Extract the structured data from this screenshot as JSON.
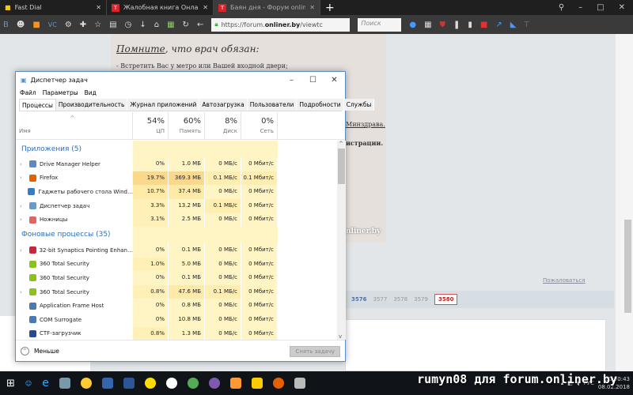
{
  "browser": {
    "tabs": [
      {
        "label": "Fast Dial"
      },
      {
        "label": "Жалобная книга Онлайн…"
      },
      {
        "label": "Баян дня - Форум onliner…",
        "active": true
      }
    ],
    "url_prefix": "https://forum.",
    "url_domain": "onliner.by",
    "url_suffix": "/viewtc",
    "search_placeholder": "Поиск"
  },
  "page": {
    "heading_underlined": "Помните",
    "heading_rest": ", что врач обязан:",
    "line1": "- Встретить Вас у метро или Вашей входной двери;",
    "frag_minzdrav": "Минздрава.",
    "frag_admin": "истрации.",
    "frag_onliner": "nliner.by",
    "complain": "Пожаловаться",
    "pager": [
      {
        "label": "3576",
        "type": "link"
      },
      {
        "label": "3577"
      },
      {
        "label": "3578"
      },
      {
        "label": "3579"
      },
      {
        "label": "3580",
        "type": "current"
      }
    ]
  },
  "taskmgr": {
    "title": "Диспетчер задач",
    "menu": [
      "Файл",
      "Параметры",
      "Вид"
    ],
    "tabs": [
      "Процессы",
      "Производительность",
      "Журнал приложений",
      "Автозагрузка",
      "Пользователи",
      "Подробности",
      "Службы"
    ],
    "columns": [
      {
        "pct": "",
        "name": "Имя"
      },
      {
        "pct": "54%",
        "name": "ЦП"
      },
      {
        "pct": "60%",
        "name": "Память"
      },
      {
        "pct": "8%",
        "name": "Диск"
      },
      {
        "pct": "0%",
        "name": "Сеть"
      }
    ],
    "groups": [
      {
        "title": "Приложения (5)",
        "rows": [
          {
            "name": "Drive Manager Helper",
            "exp": true,
            "cpu": "0%",
            "mem": "1.0 МБ",
            "disk": "0 МБ/с",
            "net": "0 Мбит/с",
            "icon": "#5a8bc4"
          },
          {
            "name": "Firefox",
            "exp": true,
            "cpu": "19.7%",
            "mem": "369.3 МБ",
            "disk": "0.1 МБ/с",
            "net": "0.1 Мбит/с",
            "icon": "#e66000",
            "hot": true
          },
          {
            "name": "Гаджеты рабочего стола Wind…",
            "exp": false,
            "cpu": "10.7%",
            "mem": "37.4 МБ",
            "disk": "0 МБ/с",
            "net": "0 Мбит/с",
            "icon": "#3a7ac0"
          },
          {
            "name": "Диспетчер задач",
            "exp": true,
            "cpu": "3.3%",
            "mem": "13.2 МБ",
            "disk": "0.1 МБ/с",
            "net": "0 Мбит/с",
            "icon": "#6a9ac8"
          },
          {
            "name": "Ножницы",
            "exp": true,
            "cpu": "3.1%",
            "mem": "2.5 МБ",
            "disk": "0 МБ/с",
            "net": "0 Мбит/с",
            "icon": "#d66"
          }
        ]
      },
      {
        "title": "Фоновые процессы (35)",
        "rows": [
          {
            "name": "32-bit Synaptics Pointing Enhan…",
            "exp": true,
            "cpu": "0%",
            "mem": "0.1 МБ",
            "disk": "0 МБ/с",
            "net": "0 Мбит/с",
            "icon": "#c8283c"
          },
          {
            "name": "360 Total Security",
            "exp": false,
            "cpu": "1.0%",
            "mem": "5.0 МБ",
            "disk": "0 МБ/с",
            "net": "0 Мбит/с",
            "icon": "#8bc21c"
          },
          {
            "name": "360 Total Security",
            "exp": false,
            "cpu": "0%",
            "mem": "0.1 МБ",
            "disk": "0 МБ/с",
            "net": "0 Мбит/с",
            "icon": "#8bc21c"
          },
          {
            "name": "360 Total Security",
            "exp": true,
            "cpu": "0.8%",
            "mem": "47.6 МБ",
            "disk": "0.1 МБ/с",
            "net": "0 Мбит/с",
            "icon": "#8bc21c"
          },
          {
            "name": "Application Frame Host",
            "exp": false,
            "cpu": "0%",
            "mem": "0.8 МБ",
            "disk": "0 МБ/с",
            "net": "0 Мбит/с",
            "icon": "#4a7ab0"
          },
          {
            "name": "COM Surrogate",
            "exp": false,
            "cpu": "0%",
            "mem": "10.8 МБ",
            "disk": "0 МБ/с",
            "net": "0 Мбит/с",
            "icon": "#4a7ab0"
          },
          {
            "name": "CTF-загрузчик",
            "exp": false,
            "cpu": "0.8%",
            "mem": "1.3 МБ",
            "disk": "0 МБ/с",
            "net": "0 Мбит/с",
            "icon": "#2a4a90"
          }
        ]
      }
    ],
    "less_label": "Меньше",
    "end_task_label": "Снять задачу"
  },
  "taskbar": {
    "lang": "РУС",
    "time": "20:30:43",
    "date": "08.02.2018"
  },
  "watermark": "rumyn08 для forum.onliner.by"
}
